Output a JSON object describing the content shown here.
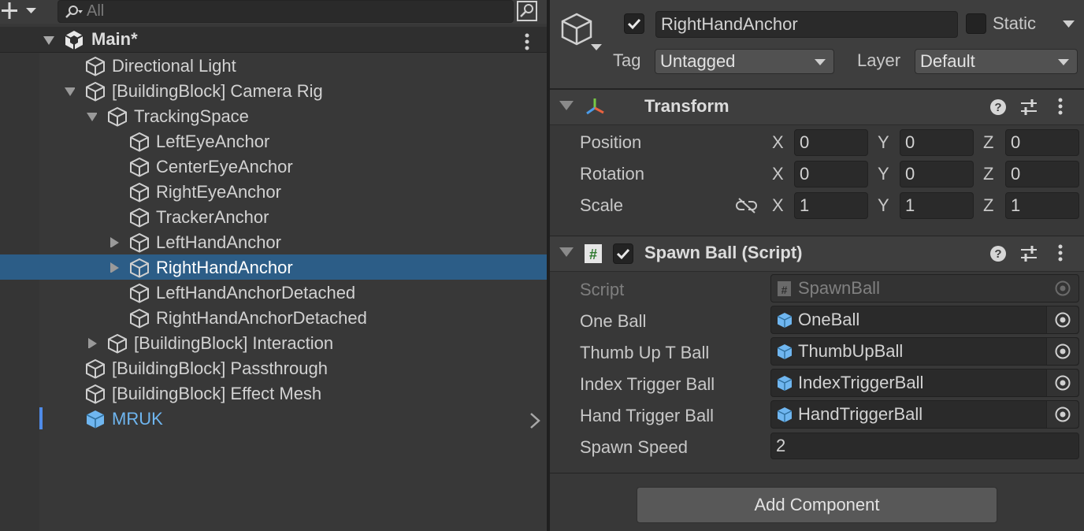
{
  "hierarchy": {
    "search": {
      "placeholder": "All",
      "value": ""
    },
    "scene": {
      "title": "Main*"
    },
    "items": [
      {
        "label": "Directional Light"
      },
      {
        "label": "[BuildingBlock] Camera Rig"
      },
      {
        "label": "TrackingSpace"
      },
      {
        "label": "LeftEyeAnchor"
      },
      {
        "label": "CenterEyeAnchor"
      },
      {
        "label": "RightEyeAnchor"
      },
      {
        "label": "TrackerAnchor"
      },
      {
        "label": "LeftHandAnchor"
      },
      {
        "label": "RightHandAnchor"
      },
      {
        "label": "LeftHandAnchorDetached"
      },
      {
        "label": "RightHandAnchorDetached"
      },
      {
        "label": "[BuildingBlock] Interaction"
      },
      {
        "label": "[BuildingBlock] Passthrough"
      },
      {
        "label": "[BuildingBlock] Effect Mesh"
      },
      {
        "label": "MRUK"
      }
    ],
    "selected_item": "RightHandAnchor"
  },
  "inspector": {
    "object_name": "RightHandAnchor",
    "active": true,
    "static_label": "Static",
    "static_checked": false,
    "tag_label": "Tag",
    "tag_value": "Untagged",
    "layer_label": "Layer",
    "layer_value": "Default",
    "transform": {
      "title": "Transform",
      "rows": [
        {
          "label": "Position",
          "x": "0",
          "y": "0",
          "z": "0"
        },
        {
          "label": "Rotation",
          "x": "0",
          "y": "0",
          "z": "0"
        },
        {
          "label": "Scale",
          "x": "1",
          "y": "1",
          "z": "1"
        }
      ],
      "axis_labels": {
        "x": "X",
        "y": "Y",
        "z": "Z"
      }
    },
    "script_component": {
      "title": "Spawn Ball (Script)",
      "enabled": true,
      "fields": [
        {
          "label": "Script",
          "value": "SpawnBall"
        },
        {
          "label": "One Ball",
          "value": "OneBall"
        },
        {
          "label": "Thumb Up T Ball",
          "value": "ThumbUpBall"
        },
        {
          "label": "Index Trigger Ball",
          "value": "IndexTriggerBall"
        },
        {
          "label": "Hand Trigger Ball",
          "value": "HandTriggerBall"
        },
        {
          "label": "Spawn Speed",
          "value": "2"
        }
      ]
    },
    "add_component_label": "Add Component"
  },
  "colors": {
    "selection": "#2c5d87",
    "prefab_blue": "#6fb6f0",
    "panel_bg": "#383838"
  }
}
